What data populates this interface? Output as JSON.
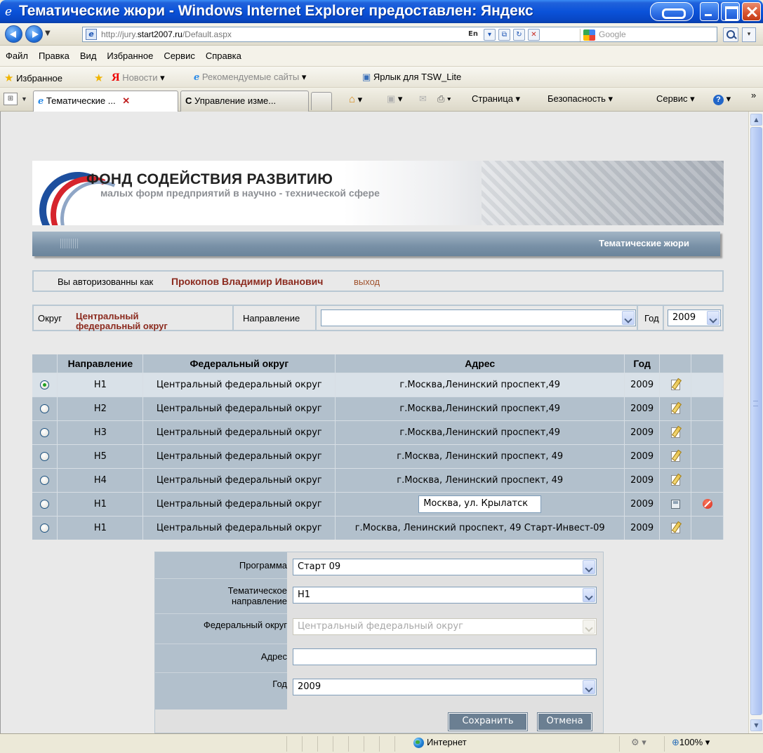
{
  "window": {
    "title": "Тематические жюри - Windows Internet Explorer предоставлен: Яндекс",
    "icon": "ie-icon"
  },
  "address_bar": {
    "url_prefix": "http://jury.",
    "url_domain": "start2007.ru",
    "url_suffix": "/Default.aspx",
    "lang": "En",
    "search_placeholder": "Google"
  },
  "menu": [
    "Файл",
    "Правка",
    "Вид",
    "Избранное",
    "Сервис",
    "Справка"
  ],
  "favorites": {
    "favorites_label": "Избранное",
    "news": "Новости",
    "recommended": "Рекомендуемые сайты",
    "shortcut": "Ярлык для TSW_Lite"
  },
  "tabs": {
    "active": "Тематические ...",
    "inactive": "Управление изме..."
  },
  "commands": {
    "page": "Страница",
    "security": "Безопасность",
    "tools": "Сервис"
  },
  "banner": {
    "title": "ФОНД СОДЕЙСТВИЯ РАЗВИТИЮ",
    "subtitle": "малых форм предприятий в научно - технической сфере"
  },
  "header": {
    "title": "Тематические жюри"
  },
  "auth": {
    "label": "Вы авторизованны как",
    "user": "Прокопов Владимир Иванович",
    "logout": "выход"
  },
  "filter": {
    "okrug_label": "Округ",
    "okrug_value_line1": "Центральный",
    "okrug_value_line2": "федеральный округ",
    "direction_label": "Направление",
    "direction_value": "",
    "year_label": "Год",
    "year_value": "2009"
  },
  "table": {
    "headers": [
      "",
      "Направление",
      "Федеральный округ",
      "Адрес",
      "Год",
      "",
      ""
    ],
    "rows": [
      {
        "dir": "Н1",
        "okrug": "Центральный федеральный округ",
        "addr": "г.Москва,Ленинский проспект,49",
        "year": "2009"
      },
      {
        "dir": "Н2",
        "okrug": "Центральный федеральный округ",
        "addr": "г.Москва,Ленинский проспект,49",
        "year": "2009"
      },
      {
        "dir": "Н3",
        "okrug": "Центральный федеральный округ",
        "addr": "г.Москва,Ленинский проспект,49",
        "year": "2009"
      },
      {
        "dir": "Н5",
        "okrug": "Центральный федеральный округ",
        "addr": "г.Москва, Ленинский проспект, 49",
        "year": "2009"
      },
      {
        "dir": "Н4",
        "okrug": "Центральный федеральный округ",
        "addr": "г.Москва, Ленинский проспект, 49",
        "year": "2009"
      },
      {
        "dir": "Н1",
        "okrug": "Центральный федеральный округ",
        "addr": "Москва, ул. Крылатск",
        "year": "2009"
      },
      {
        "dir": "Н1",
        "okrug": "Центральный федеральный округ",
        "addr": "г.Москва, Ленинский проспект, 49 Старт-Инвест-09",
        "year": "2009"
      }
    ]
  },
  "form": {
    "program_label": "Программа",
    "program_value": "Старт 09",
    "theme_label_line1": "Тематическое",
    "theme_label_line2": "направление",
    "theme_value": "Н1",
    "okrug_label": "Федеральный округ",
    "okrug_value": "Центральный федеральный округ",
    "address_label": "Адрес",
    "address_value": "",
    "year_label": "Год",
    "year_value": "2009",
    "save_label": "Сохранить",
    "cancel_label": "Отмена"
  },
  "status": {
    "zone": "Интернет",
    "zoom": "100%"
  }
}
